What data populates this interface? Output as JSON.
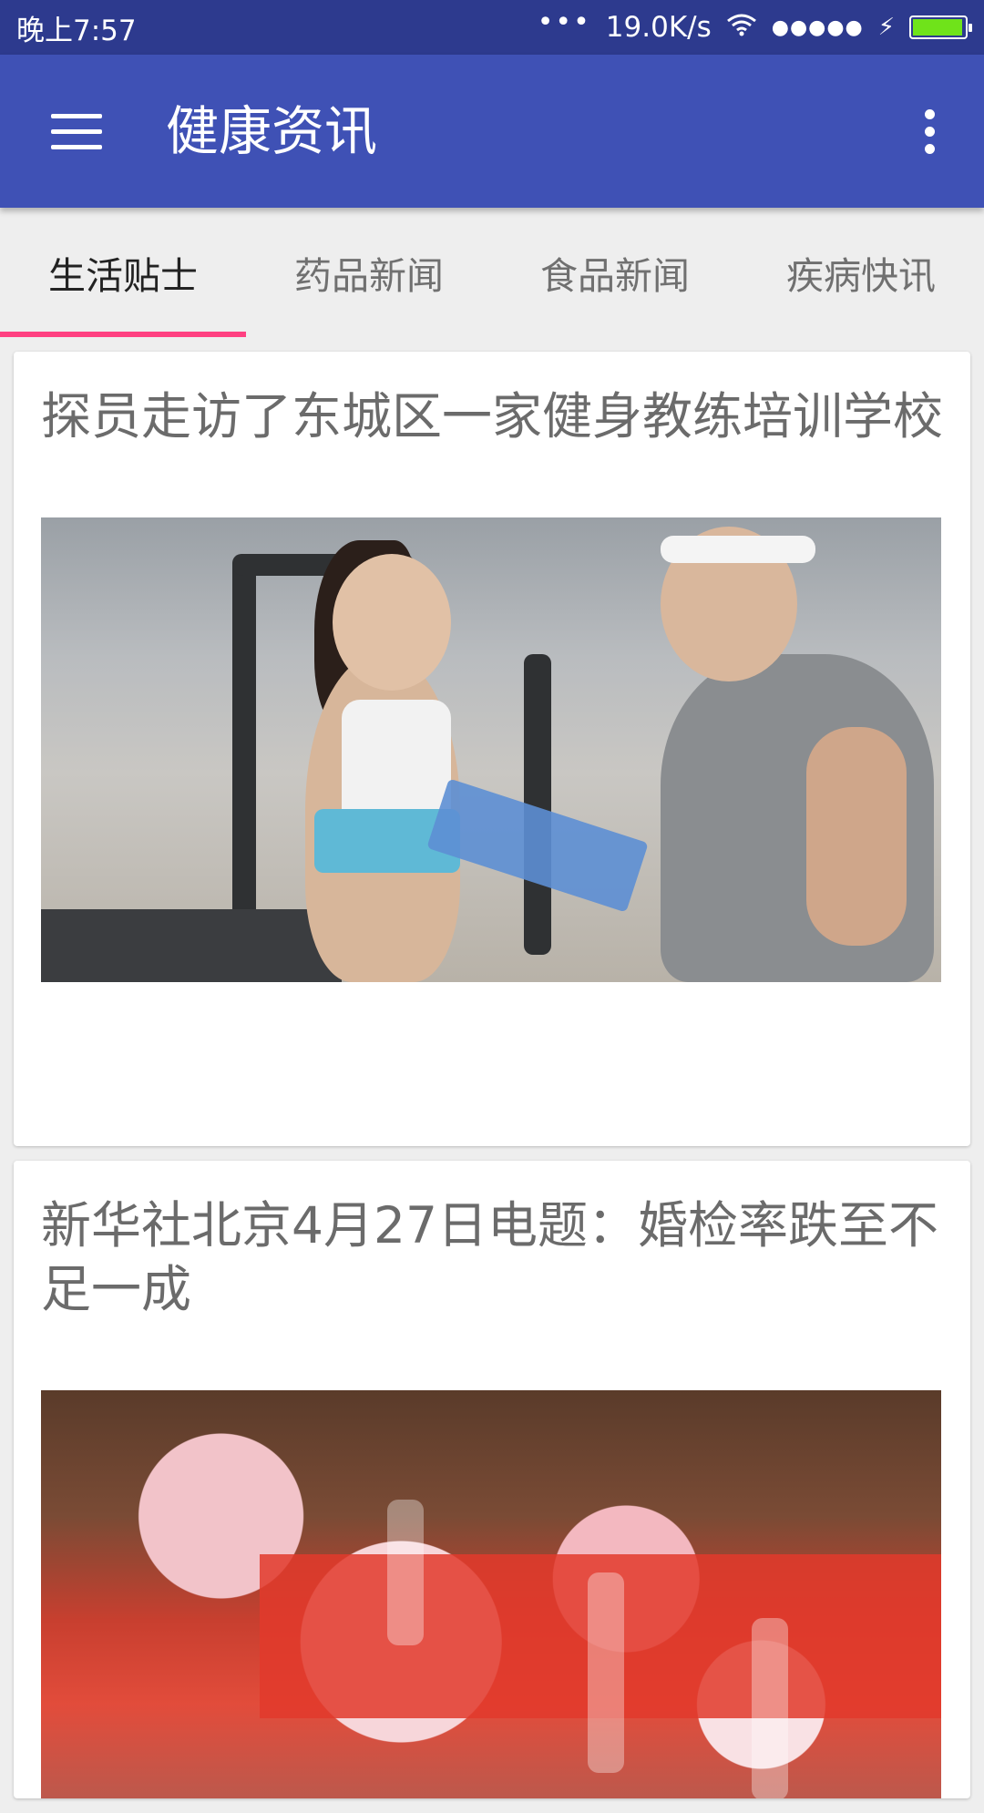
{
  "status_bar": {
    "time": "晚上7:57",
    "network_speed": "19.0K/s",
    "icons": [
      "more-dots-icon",
      "wifi-icon",
      "signal-dots-icon",
      "charging-bolt-icon",
      "battery-icon"
    ],
    "battery_color": "#6fe31a"
  },
  "toolbar": {
    "title": "健康资讯",
    "menu_icon": "hamburger-menu-icon",
    "overflow_icon": "more-vert-icon",
    "color": "#3f51b5"
  },
  "tabs": [
    {
      "label": "生活贴士",
      "active": true
    },
    {
      "label": "药品新闻",
      "active": false
    },
    {
      "label": "食品新闻",
      "active": false
    },
    {
      "label": "疾病快讯",
      "active": false
    }
  ],
  "tab_indicator_color": "#ff4081",
  "articles": [
    {
      "title": "探员走访了东城区一家健身教练培训学校",
      "image": "gym-trainer-photo"
    },
    {
      "title": "新华社北京4月27日电题：婚检率跌至不足一成",
      "image": "wedding-flowers-photo"
    }
  ]
}
